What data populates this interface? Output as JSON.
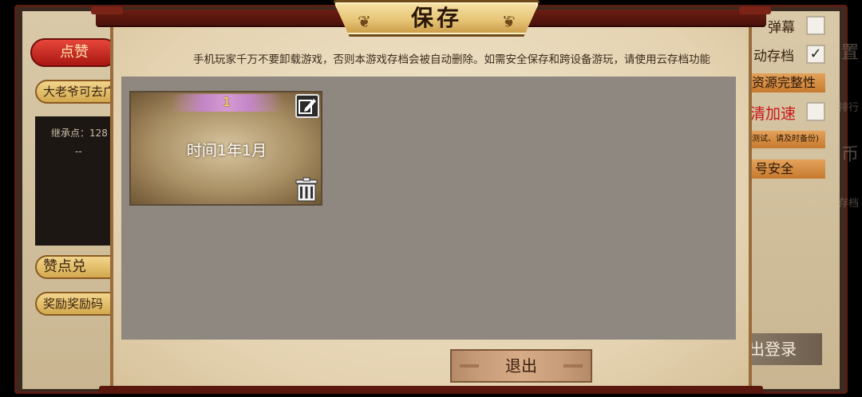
{
  "background": {
    "like_button": "点赞",
    "pill_1": "大老爷可去广",
    "inherit_label": "继承点：128",
    "inherit_dash": "--",
    "pill_2": "赞点兑",
    "pill_3": "奖励奖励码",
    "danmaku_label": "弹幕",
    "autosave_label": "动存档",
    "resource_label": "资源完整性",
    "accel_label": "清加速",
    "small_note": "测试、请及时备份)",
    "account_label": "号安全",
    "logout_label": "出登录",
    "side_icons": [
      "置",
      "排行",
      "币",
      "存档"
    ]
  },
  "modal": {
    "title": "保存",
    "notice": "手机玩家千万不要卸载游戏，否则本游戏存档会被自动删除。如需安全保存和跨设备游玩，请使用云存档功能",
    "notice_tail": "。",
    "slots": [
      {
        "number": "1",
        "time": "时间1年1月"
      }
    ],
    "exit_label": "退出"
  },
  "icons": {
    "edit": "edit-icon",
    "trash": "trash-icon"
  }
}
